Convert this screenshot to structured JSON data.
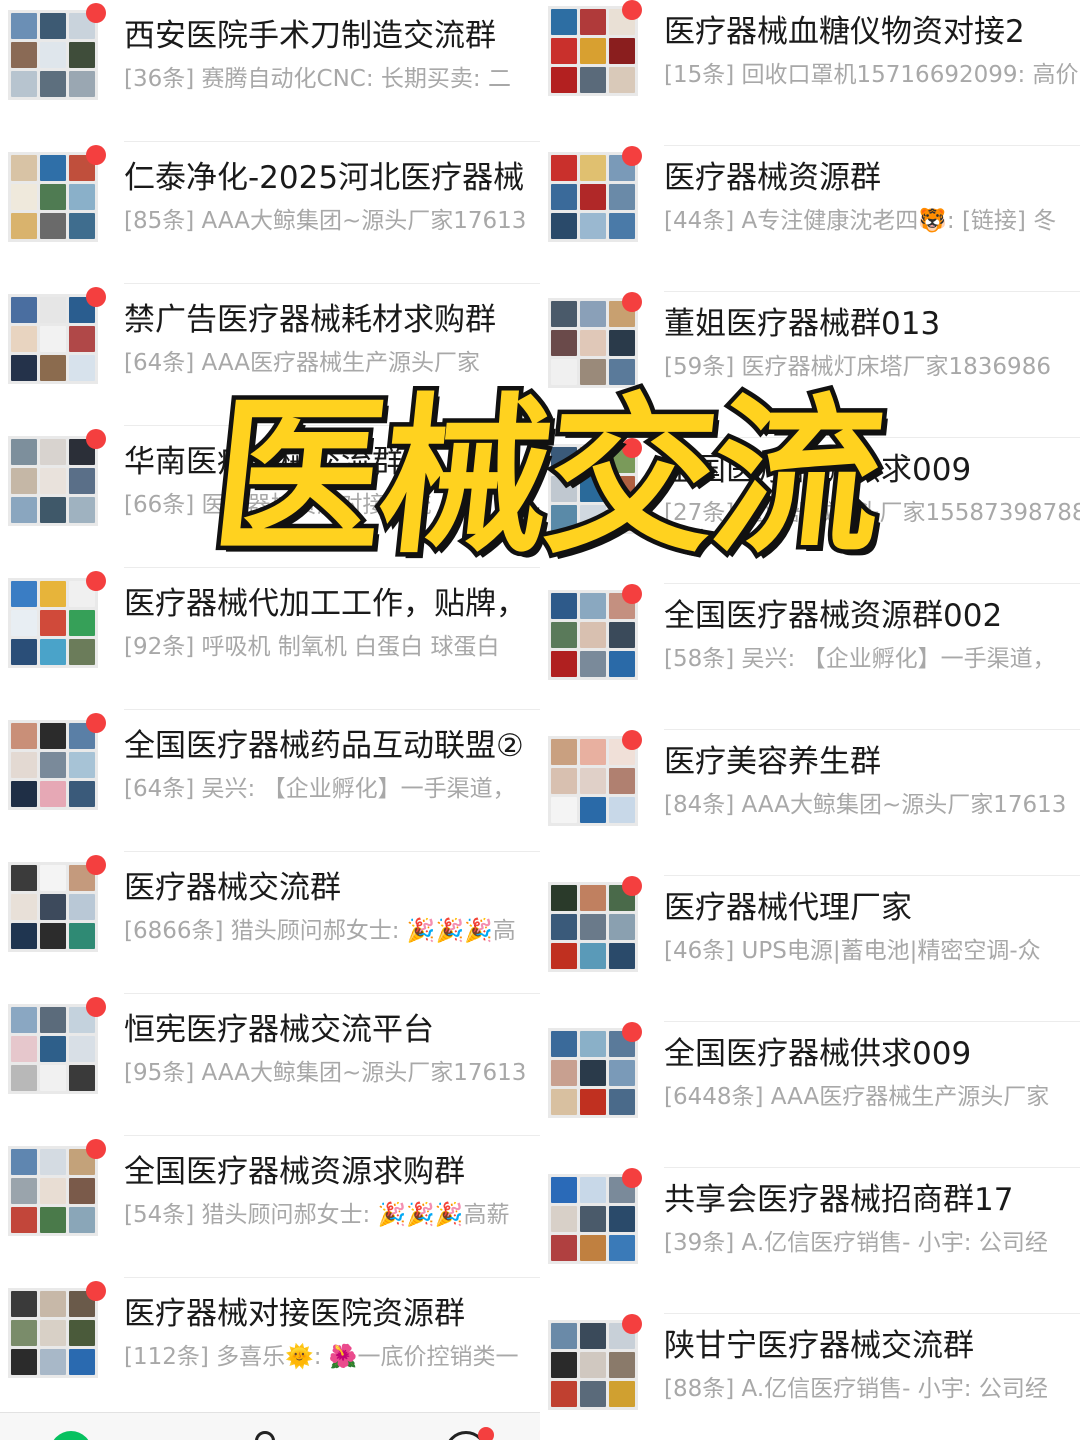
{
  "overlay": {
    "banner_text": "医械交流"
  },
  "colors": {
    "accent": "#07c160",
    "unread_dot": "#f43f3f",
    "banner_fill": "#ffd21f",
    "banner_stroke": "#111111",
    "title_text": "#1a1a1a",
    "preview_text": "#a8a8a8"
  },
  "left_chats": [
    {
      "title": "西安医院手术刀制造交流群",
      "preview": "[36条] 赛腾自动化CNC: 长期买卖: 二",
      "avatar_colors": [
        "#6b8fb5",
        "#3d5a73",
        "#c9d3dc",
        "#8a6a55",
        "#dfe6ec",
        "#3f4d3a",
        "#b7c4cf",
        "#5d6f7e",
        "#9aa7b2"
      ]
    },
    {
      "title": "仁泰净化-2025河北医疗器械",
      "preview": "[85条] AAA大鲸集团~源头厂家17613",
      "avatar_colors": [
        "#d8c3a5",
        "#2f6fa8",
        "#c04f3c",
        "#efe9dc",
        "#4f7b52",
        "#8ab0c9",
        "#d9b36d",
        "#6a6a6a",
        "#3f6d8e"
      ]
    },
    {
      "title": "禁广告医疗器械耗材求购群",
      "preview": "[64条] AAA医疗器械生产源头厂家",
      "avatar_colors": [
        "#4a6ea0",
        "#e6e6e6",
        "#2a5d8f",
        "#e8d4c0",
        "#f2f2f2",
        "#b04848",
        "#24324a",
        "#8b6b4e",
        "#d7e2ec"
      ]
    },
    {
      "title": "华南医疗器械交流群",
      "preview": "[66条] 医疗器械资源对接交流",
      "avatar_colors": [
        "#7d8f9c",
        "#d8d3cf",
        "#2b2f38",
        "#c5b7a6",
        "#e9e2dc",
        "#5a6f88",
        "#8aa6bf",
        "#3f5869",
        "#9fb2c0"
      ]
    },
    {
      "title": "医疗器械代加工工作，贴牌，",
      "preview": "[92条] 呼吸机 制氧机 白蛋白 球蛋白",
      "avatar_colors": [
        "#3a7dc4",
        "#e7b43a",
        "#f0f0f0",
        "#e8eef3",
        "#d04a3a",
        "#36a058",
        "#2a4e78",
        "#4aa3c9",
        "#6b7c5a"
      ]
    },
    {
      "title": "全国医疗器械药品互动联盟②",
      "preview": "[64条] 吴兴: 【企业孵化】一手渠道，",
      "avatar_colors": [
        "#c98f78",
        "#2b2b2b",
        "#5a7fa6",
        "#e3d9d2",
        "#7a8a9a",
        "#a7c3d6",
        "#1f2f46",
        "#e6a8b5",
        "#3a5a7a"
      ]
    },
    {
      "title": "医疗器械交流群",
      "preview": "[6866条] 猎头顾问郝女士: 🎉🎉🎉高",
      "avatar_colors": [
        "#3b3b3b",
        "#f4f4f4",
        "#c49a7d",
        "#e8e0d8",
        "#3d4a5c",
        "#b9c8d6",
        "#1f3550",
        "#2c2c2c",
        "#2f8a74"
      ]
    },
    {
      "title": "恒宪医疗器械交流平台",
      "preview": "[95条] AAA大鲸集团~源头厂家17613",
      "avatar_colors": [
        "#8aa7c2",
        "#5b6b7b",
        "#c4d2dd",
        "#e6c7cc",
        "#2e5f8a",
        "#d8dfe6",
        "#b8b8b8",
        "#f1f1f1",
        "#3a3a3a"
      ]
    },
    {
      "title": "全国医疗器械资源求购群",
      "preview": "[54条] 猎头顾问郝女士: 🎉🎉🎉高薪",
      "avatar_colors": [
        "#5f86b0",
        "#d4dbe2",
        "#c3a27a",
        "#9aa4ac",
        "#e8ddd3",
        "#7a5a4a",
        "#c2463a",
        "#4a7a4a",
        "#8aa6b8"
      ]
    },
    {
      "title": "医疗器械对接医院资源群",
      "preview": "[112条] 多喜乐🌞: 🌺一底价控销类一",
      "avatar_colors": [
        "#3a3a3a",
        "#c7b8a8",
        "#6a5a4a",
        "#7a8c6a",
        "#d8d0c6",
        "#4a5a3a",
        "#2b2b2b",
        "#a8b8c8",
        "#2a6ab0"
      ]
    }
  ],
  "right_chats": [
    {
      "title": "医疗器械血糖仪物资对接2",
      "preview": "[15条] 回收口罩机15716692099: 高价",
      "avatar_colors": [
        "#2d6ea3",
        "#b03a3a",
        "#e9e0d5",
        "#c9302c",
        "#d8a030",
        "#8a1e1e",
        "#b32020",
        "#5a6a7a",
        "#d9c9b9"
      ]
    },
    {
      "title": "医疗器械资源群",
      "preview": "[44条] A专注健康沈老四🐯: [链接] 冬",
      "avatar_colors": [
        "#c9302c",
        "#e0c070",
        "#7a9ab8",
        "#3a6a9a",
        "#b02828",
        "#6a8aa8",
        "#2a4a6a",
        "#9ab8d0",
        "#4a7aa8"
      ]
    },
    {
      "title": "董姐医疗器械群013",
      "preview": "[59条] 医疗器械灯床塔厂家1836986",
      "avatar_colors": [
        "#4a5a6a",
        "#8aa0b8",
        "#c8a070",
        "#6a4a4a",
        "#e0c8b8",
        "#2a3a4a",
        "#f0f0f0",
        "#9a8a7a",
        "#5a7a9a"
      ]
    },
    {
      "title": "全国医疗器械供求009",
      "preview": "[27条] 医疗器械源头厂家15587398788",
      "avatar_colors": [
        "#3a5a7a",
        "#e0a040",
        "#7a9a5a",
        "#c0c8d0",
        "#2a6a9a",
        "#b06040",
        "#5a8aa8",
        "#d0d8e0",
        "#8a6a5a"
      ]
    },
    {
      "title": "全国医疗器械资源群002",
      "preview": "[58条] 吴兴: 【企业孵化】一手渠道，",
      "avatar_colors": [
        "#2e5a8a",
        "#8aa8c0",
        "#c49080",
        "#5a7a5a",
        "#d8c0b0",
        "#3a4a5a",
        "#b02020",
        "#7a8a9a",
        "#2a6aa8"
      ]
    },
    {
      "title": "医疗美容养生群",
      "preview": "[84条] AAA大鲸集团~源头厂家17613",
      "avatar_colors": [
        "#c9a080",
        "#e8b0a0",
        "#f0e0d8",
        "#d8c0b0",
        "#e0d0c8",
        "#b08070",
        "#f4f4f4",
        "#2a6aa8",
        "#c8d8e8"
      ]
    },
    {
      "title": "医疗器械代理厂家",
      "preview": "[46条] UPS电源|蓄电池|精密空调-众",
      "avatar_colors": [
        "#2a3a2a",
        "#c08060",
        "#4a6a4a",
        "#3a5a7a",
        "#6a7a8a",
        "#8aa0b0",
        "#c03020",
        "#5a9ab8",
        "#2a4a6a"
      ]
    },
    {
      "title": "全国医疗器械供求009",
      "preview": "[6448条] AAA医疗器械生产源头厂家",
      "avatar_colors": [
        "#3a6a9a",
        "#8ab0c8",
        "#5a7a9a",
        "#c8a090",
        "#2a3a4a",
        "#7a9ab8",
        "#d8c0a0",
        "#c03020",
        "#4a6a8a"
      ]
    },
    {
      "title": "共享会医疗器械招商群17",
      "preview": "[39条] A.亿信医疗销售- 小宇: 公司经",
      "avatar_colors": [
        "#2a6ab8",
        "#c8d8e8",
        "#7a8a9a",
        "#d8d0c8",
        "#4a5a6a",
        "#2a4a6a",
        "#b04040",
        "#c08040",
        "#3a7ab8"
      ]
    },
    {
      "title": "陕甘宁医疗器械交流群",
      "preview": "[88条] A.亿信医疗销售- 小宇: 公司经",
      "avatar_colors": [
        "#6a8aa8",
        "#3a4a5a",
        "#c8d0d8",
        "#2a2a2a",
        "#d0c8c0",
        "#8a7a6a",
        "#c04030",
        "#5a6a7a",
        "#d0a030"
      ]
    }
  ],
  "tabbar": {
    "items": [
      "chats-icon",
      "contacts-icon",
      "discover-icon"
    ]
  }
}
